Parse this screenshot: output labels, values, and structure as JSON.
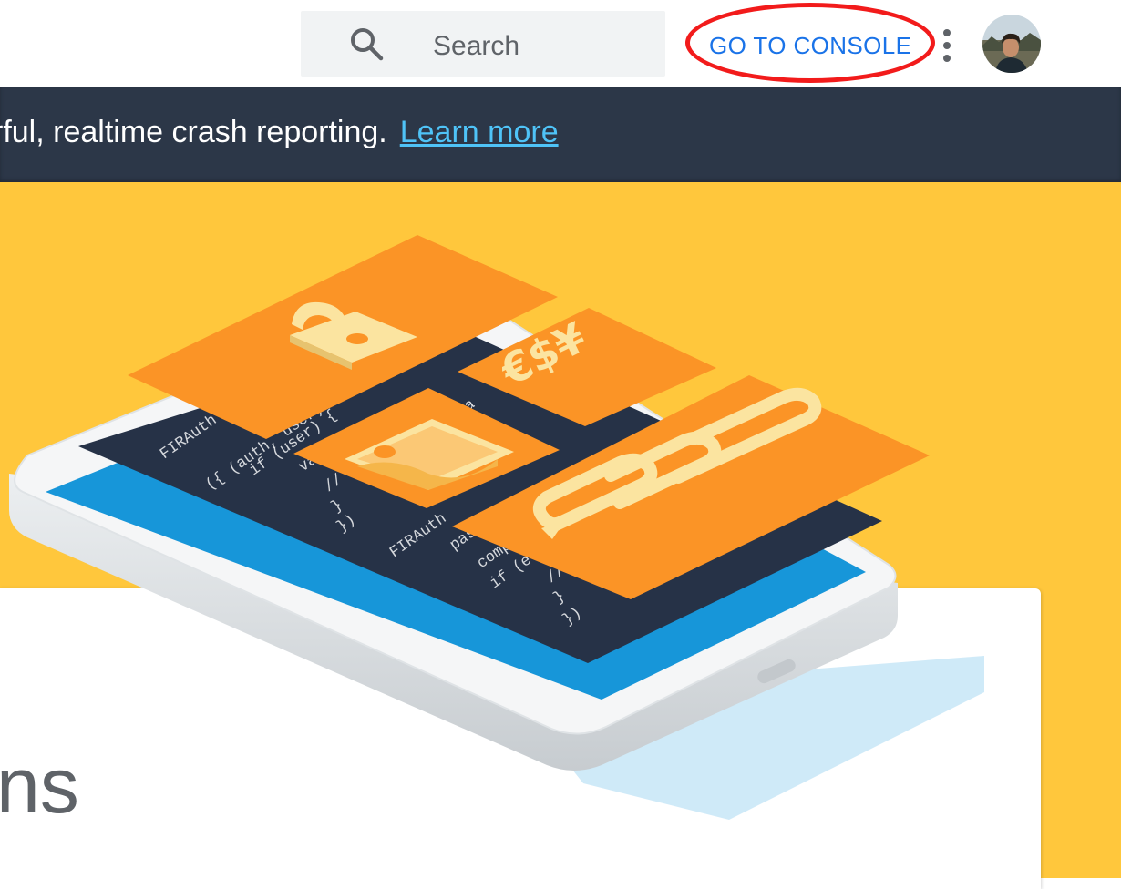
{
  "header": {
    "search": {
      "placeholder": "Search",
      "icon": "search-icon"
    },
    "console_button": {
      "label": "GO TO CONSOLE",
      "color": "#1a73e8",
      "highlight_color": "#f21b1b"
    },
    "menu": {
      "icon": "more-vert-icon"
    },
    "avatar": {
      "icon": "user-avatar"
    }
  },
  "banner": {
    "message": "rful, realtime crash reporting.",
    "link_label": "Learn more",
    "background": "#2c3748",
    "link_color": "#4fc3f7"
  },
  "hero": {
    "background": "#ffc73c",
    "code_lines_a": [
      "FIRAuth",
      "({ (auth, user) in",
      "if (user) {",
      "va",
      "//",
      "}",
      "})"
    ],
    "code_lines_b": [
      "FIRAuth",
      "pass",
      "comp",
      "if (e",
      "//",
      "}",
      "})"
    ],
    "code_snippet_c": "ema",
    "currency_symbols": "€$¥"
  },
  "content": {
    "title_fragment": "ns"
  }
}
